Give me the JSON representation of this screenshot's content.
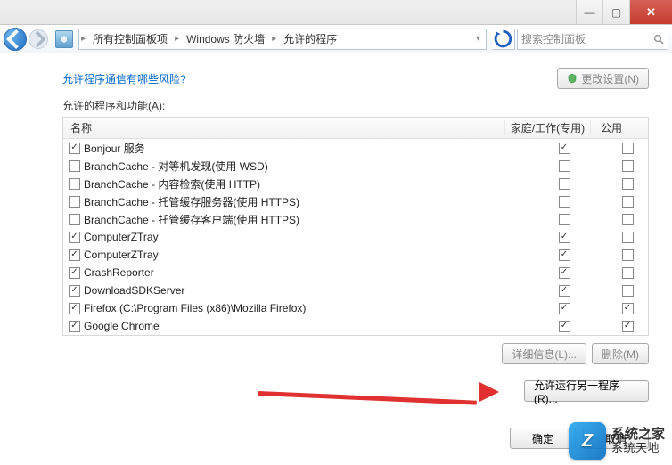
{
  "titlebar": {
    "min": "—",
    "max": "▢",
    "close": "✕"
  },
  "nav": {
    "crumb1": "所有控制面板项",
    "crumb2": "Windows 防火墙",
    "crumb3": "允许的程序",
    "search_placeholder": "搜索控制面板"
  },
  "content": {
    "risk_link": "允许程序通信有哪些风险?",
    "change_settings": "更改设置(N)",
    "section_label": "允许的程序和功能(A):",
    "col_name": "名称",
    "col_home": "家庭/工作(专用)",
    "col_public": "公用",
    "details_btn": "详细信息(L)...",
    "delete_btn": "删除(M)",
    "allow_another": "允许运行另一程序(R)...",
    "rows": [
      {
        "name": "Bonjour 服务",
        "c1": true,
        "home": true,
        "pub": false
      },
      {
        "name": "BranchCache - 对等机发现(使用 WSD)",
        "c1": false,
        "home": false,
        "pub": false
      },
      {
        "name": "BranchCache - 内容检索(使用 HTTP)",
        "c1": false,
        "home": false,
        "pub": false
      },
      {
        "name": "BranchCache - 托管缓存服务器(使用 HTTPS)",
        "c1": false,
        "home": false,
        "pub": false
      },
      {
        "name": "BranchCache - 托管缓存客户端(使用 HTTPS)",
        "c1": false,
        "home": false,
        "pub": false
      },
      {
        "name": "ComputerZTray",
        "c1": true,
        "home": true,
        "pub": false
      },
      {
        "name": "ComputerZTray",
        "c1": true,
        "home": true,
        "pub": false
      },
      {
        "name": "CrashReporter",
        "c1": true,
        "home": true,
        "pub": false
      },
      {
        "name": "DownloadSDKServer",
        "c1": true,
        "home": true,
        "pub": false
      },
      {
        "name": "Firefox (C:\\Program Files (x86)\\Mozilla Firefox)",
        "c1": true,
        "home": true,
        "pub": true
      },
      {
        "name": "Google Chrome",
        "c1": true,
        "home": true,
        "pub": true
      }
    ]
  },
  "footer": {
    "ok": "确定",
    "cancel": "取消"
  },
  "watermark": {
    "cn": "系统之家",
    "en": "系统天地"
  }
}
